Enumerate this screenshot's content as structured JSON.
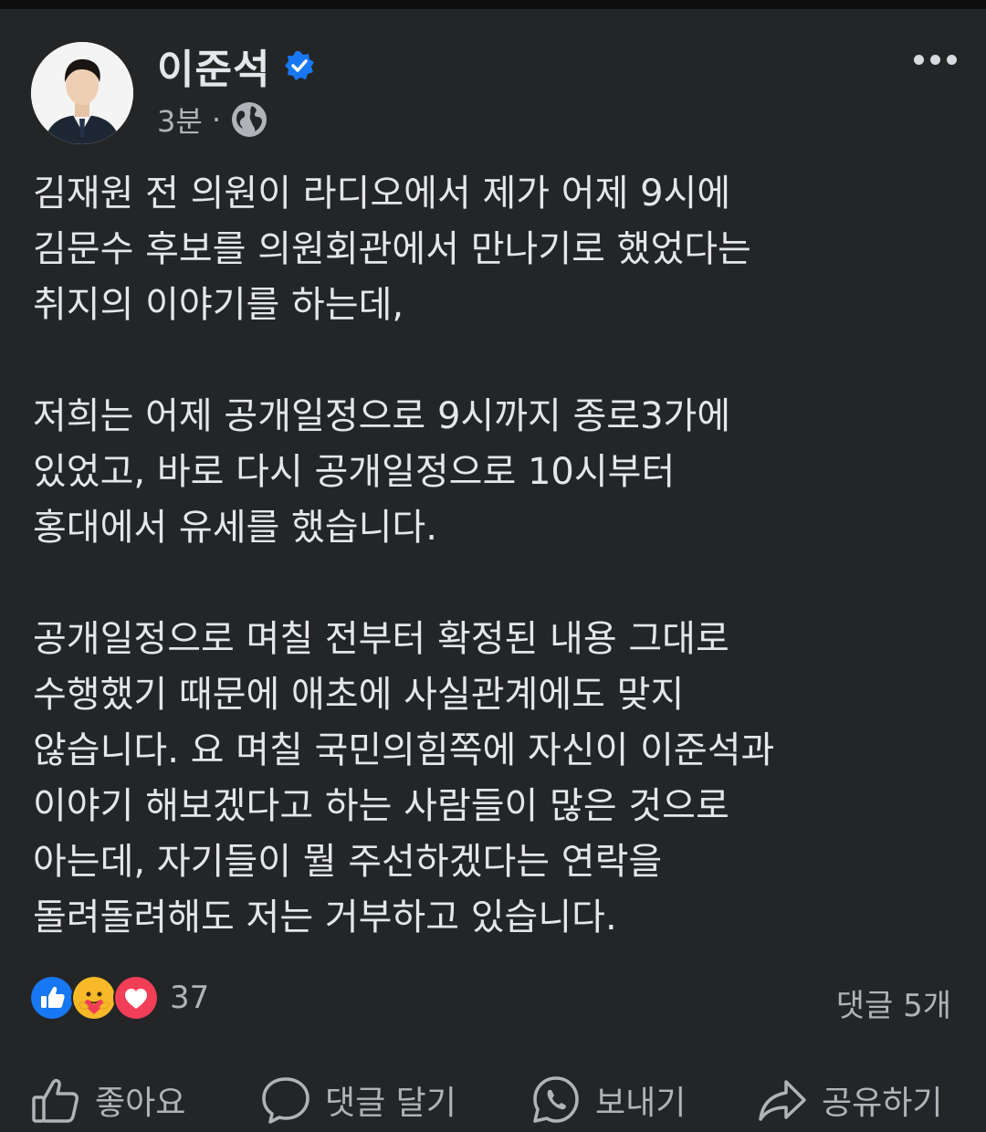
{
  "post": {
    "author": "이준석",
    "time": "3분",
    "separator": "·",
    "paragraphs": [
      [
        "김재원 전 의원이 라디오에서 제가 어제 9시에",
        "김문수 후보를 의원회관에서 만나기로 했었다는",
        "취지의 이야기를 하는데,"
      ],
      [
        "저희는 어제 공개일정으로 9시까지 종로3가에",
        "있었고, 바로 다시 공개일정으로 10시부터",
        "홍대에서 유세를 했습니다."
      ],
      [
        "공개일정으로 며칠 전부터 확정된 내용 그대로",
        "수행했기 때문에 애초에 사실관계에도 맞지",
        "않습니다. 요 며칠 국민의힘쪽에 자신이 이준석과",
        "이야기 해보겠다고 하는 사람들이 많은 것으로",
        "아는데, 자기들이 뭘 주선하겠다는 연락을",
        "돌려돌려해도 저는 거부하고 있습니다."
      ]
    ]
  },
  "stats": {
    "reaction_count": "37",
    "comments": "댓글 5개",
    "reaction_icons": [
      "like-icon",
      "care-icon",
      "love-icon"
    ]
  },
  "actions": {
    "like": "좋아요",
    "comment": "댓글 달기",
    "send": "보내기",
    "share": "공유하기"
  },
  "colors": {
    "background": "#242526",
    "text": "#e4e6eb",
    "secondary": "#b0b3b8",
    "like_blue": "#1877f2",
    "love_red": "#f33e58",
    "verified_blue": "#1877f2"
  }
}
